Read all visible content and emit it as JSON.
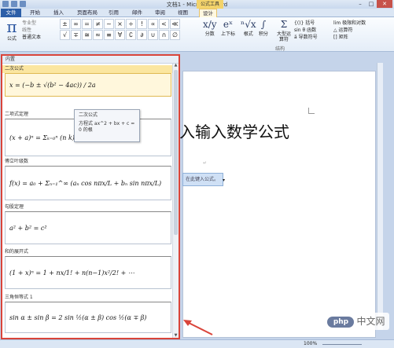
{
  "window": {
    "title": "文档1 - Microsoft Word",
    "context_tab": "公式工具"
  },
  "tabs": [
    "文件",
    "开始",
    "插入",
    "页面布局",
    "引用",
    "邮件",
    "审阅",
    "视图",
    "设计"
  ],
  "ribbon": {
    "equation_label": "公式",
    "tools": [
      "专业型",
      "线性",
      "普通文本"
    ],
    "symbols": [
      "±",
      "∞",
      "=",
      "≠",
      "~",
      "×",
      "÷",
      "!",
      "∝",
      "<",
      "≪",
      "√",
      "∓",
      "≅",
      "≈",
      "≡",
      "∀",
      "∁",
      "∂",
      "∪",
      "∩",
      "∅",
      "%"
    ],
    "structures": [
      {
        "glyph": "x/y",
        "label": "分数"
      },
      {
        "glyph": "eˣ",
        "label": "上下标"
      },
      {
        "glyph": "ⁿ√x",
        "label": "根式"
      },
      {
        "glyph": "∫",
        "label": "积分"
      },
      {
        "glyph": "Σ",
        "label": "大型运算符"
      }
    ],
    "right_list_1": [
      "{()} 括号",
      "sin θ 函数",
      "ä 导数符号"
    ],
    "right_list_2": [
      "lim 极限和对数",
      "△ 运算符",
      "[] 矩阵"
    ],
    "group_structures": "结构"
  },
  "panel": {
    "header": "内置",
    "entries": [
      {
        "title": "二次公式",
        "formula": "x = (−b ± √(b² − 4ac)) / 2a"
      },
      {
        "title": "二项式定理",
        "formula": "(x + a)ⁿ = Σₖ₌₀ⁿ (n k) xᵏ aⁿ⁻ᵏ"
      },
      {
        "title": "傅立叶级数",
        "formula": "f(x) = a₀ + Σₙ₌₁^∞ (aₙ cos nπx/L + bₙ sin nπx/L)"
      },
      {
        "title": "勾股定理",
        "formula": "a² + b² = c²"
      },
      {
        "title": "和的展开式",
        "formula": "(1 + x)ⁿ = 1 + nx/1! + n(n−1)x²/2! + ⋯"
      },
      {
        "title": "三角恒等式 1",
        "formula": "sin α ± sin β = 2 sin ½(α ± β) cos ½(α ∓ β)"
      }
    ],
    "tooltip": {
      "title": "二次公式",
      "body": "方程式 ax^2 + bx + c = 0 的根"
    }
  },
  "document": {
    "heading": "入输入数学公式",
    "placeholder": "在此键入公式。"
  },
  "status": {
    "zoom": "100%"
  },
  "watermark": {
    "logo": "php",
    "text": "中文网"
  },
  "colors": {
    "highlight_border": "#d9443a",
    "selected_entry": "#fbe6a0",
    "file_tab": "#2d5fa8"
  }
}
